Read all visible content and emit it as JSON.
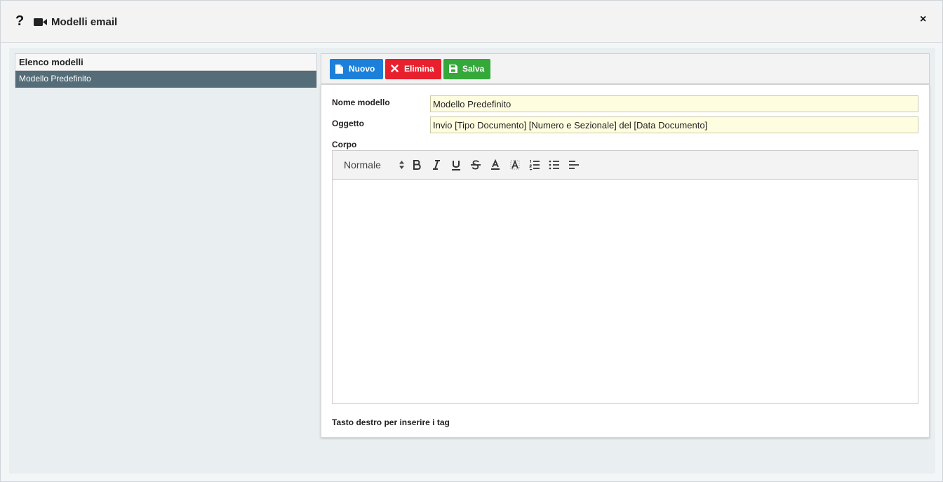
{
  "dialog": {
    "title": "Modelli email",
    "help_glyph": "?",
    "close_glyph": "×"
  },
  "left_panel": {
    "header": "Elenco modelli",
    "items": [
      {
        "label": "Modello Predefinito",
        "selected": true
      }
    ]
  },
  "toolbar": {
    "new_label": "Nuovo",
    "delete_label": "Elimina",
    "save_label": "Salva"
  },
  "form": {
    "name_label": "Nome modello",
    "name_value": "Modello Predefinito",
    "subject_label": "Oggetto",
    "subject_value": "Invio [Tipo Documento] [Numero e Sezionale] del [Data Documento]",
    "body_label": "Corpo",
    "hint": "Tasto destro per inserire i tag"
  },
  "editor": {
    "format_selected": "Normale",
    "tools": [
      "bold-icon",
      "italic-icon",
      "underline-icon",
      "strikethrough-icon",
      "text-color-icon",
      "background-color-icon",
      "ordered-list-icon",
      "bullet-list-icon",
      "align-icon"
    ]
  },
  "colors": {
    "new_button": "#1c7fd9",
    "delete_button": "#e8202d",
    "save_button": "#35a83a",
    "selected_item": "#546d78",
    "input_background": "#fffde0"
  }
}
